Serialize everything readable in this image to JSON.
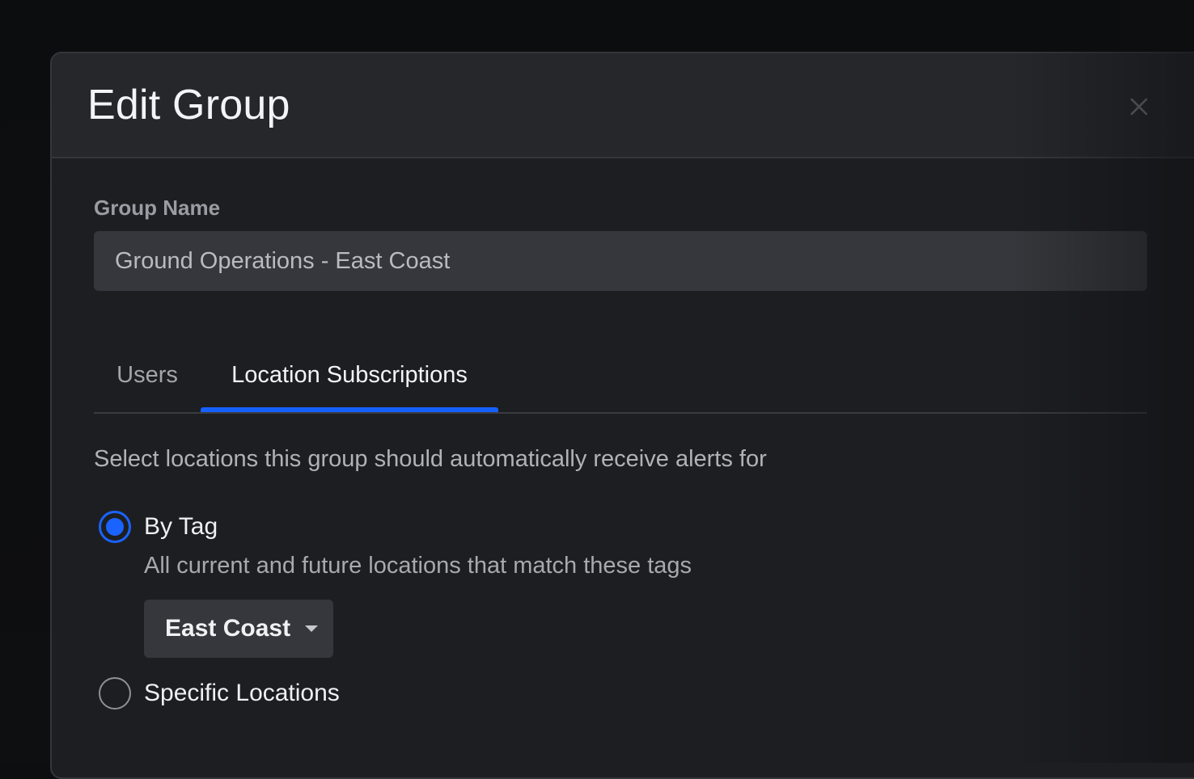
{
  "modal": {
    "title": "Edit Group",
    "close_icon": "close-icon"
  },
  "form": {
    "group_name_label": "Group Name",
    "group_name_value": "Ground Operations - East Coast"
  },
  "tabs": [
    {
      "label": "Users",
      "active": false
    },
    {
      "label": "Location Subscriptions",
      "active": true
    }
  ],
  "subscriptions": {
    "description": "Select locations this group should automatically receive alerts for",
    "options": [
      {
        "label": "By Tag",
        "selected": true,
        "help": "All current and future locations that match these tags"
      },
      {
        "label": "Specific Locations",
        "selected": false
      }
    ],
    "tag_select": {
      "value": "East Coast",
      "icon": "caret-down-icon"
    }
  },
  "colors": {
    "accent": "#1560ff",
    "modal_bg": "#1d1e21",
    "header_bg": "#26272b",
    "input_bg": "#36373c"
  }
}
